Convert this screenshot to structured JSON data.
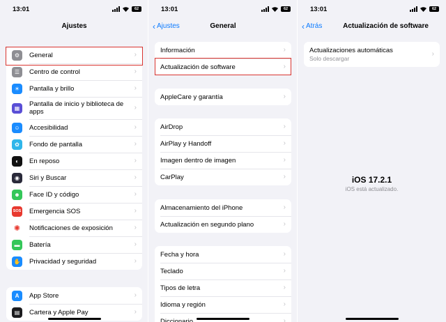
{
  "status": {
    "time": "13:01",
    "battery": "62"
  },
  "screen1": {
    "title": "Ajustes",
    "group1": [
      {
        "label": "General",
        "icon": "gear-icon",
        "color": "#8e8e93",
        "glyph": "⚙"
      },
      {
        "label": "Centro de control",
        "icon": "switches-icon",
        "color": "#8e8e93",
        "glyph": "☰"
      },
      {
        "label": "Pantalla y brillo",
        "icon": "sun-icon",
        "color": "#1a8cff",
        "glyph": "☀"
      },
      {
        "label": "Pantalla de inicio y biblioteca de apps",
        "icon": "home-grid-icon",
        "color": "#5a4fd6",
        "glyph": "▦"
      },
      {
        "label": "Accesibilidad",
        "icon": "accessibility-icon",
        "color": "#1a8cff",
        "glyph": "☺"
      },
      {
        "label": "Fondo de pantalla",
        "icon": "flower-icon",
        "color": "#2fb6ea",
        "glyph": "✿"
      },
      {
        "label": "En reposo",
        "icon": "standby-icon",
        "color": "#111111",
        "glyph": "◐"
      },
      {
        "label": "Siri y Buscar",
        "icon": "siri-icon",
        "color": "#2a2a3a",
        "glyph": "◉"
      },
      {
        "label": "Face ID y código",
        "icon": "faceid-icon",
        "color": "#34c759",
        "glyph": "☻"
      },
      {
        "label": "Emergencia SOS",
        "icon": "sos-icon",
        "color": "#e8392f",
        "glyph": "SOS"
      },
      {
        "label": "Notificaciones de exposición",
        "icon": "exposure-icon",
        "color": "#ffffff",
        "glyph": "✺"
      },
      {
        "label": "Batería",
        "icon": "battery-icon",
        "color": "#34c759",
        "glyph": "▬"
      },
      {
        "label": "Privacidad y seguridad",
        "icon": "hand-icon",
        "color": "#1a8cff",
        "glyph": "✋"
      }
    ],
    "group2": [
      {
        "label": "App Store",
        "icon": "appstore-icon",
        "color": "#1a8cff",
        "glyph": "A"
      },
      {
        "label": "Cartera y Apple Pay",
        "icon": "wallet-icon",
        "color": "#1c1c1e",
        "glyph": "▤"
      }
    ]
  },
  "screen2": {
    "back": "Ajustes",
    "title": "General",
    "groups": [
      [
        "Información",
        "Actualización de software"
      ],
      [
        "AppleCare y garantía"
      ],
      [
        "AirDrop",
        "AirPlay y Handoff",
        "Imagen dentro de imagen",
        "CarPlay"
      ],
      [
        "Almacenamiento del iPhone",
        "Actualización en segundo plano"
      ],
      [
        "Fecha y hora",
        "Teclado",
        "Tipos de letra",
        "Idioma y región",
        "Diccionario"
      ]
    ]
  },
  "screen3": {
    "back": "Atrás",
    "title": "Actualización de software",
    "auto_label": "Actualizaciones automáticas",
    "auto_value": "Solo descargar",
    "version": "iOS 17.2.1",
    "version_status": "iOS está actualizado."
  },
  "colors": {
    "accent": "#0a7aff",
    "highlight": "#d9342f",
    "background": "#f2f2f7"
  }
}
